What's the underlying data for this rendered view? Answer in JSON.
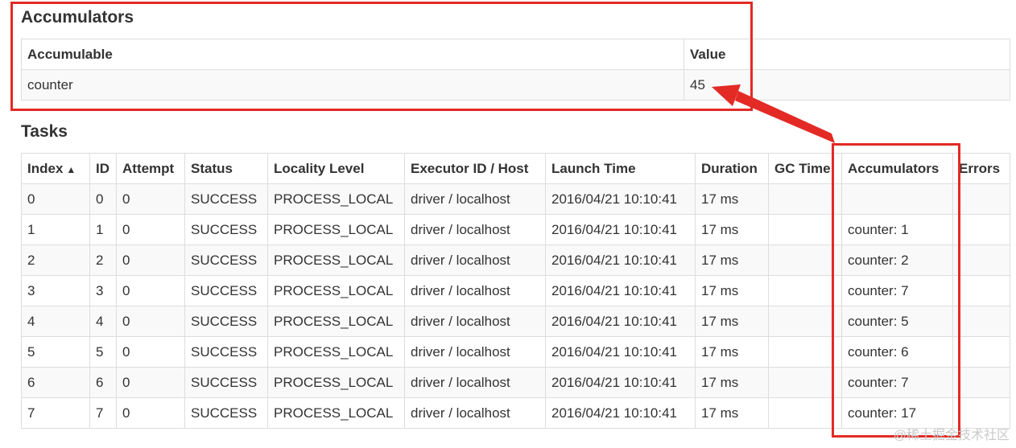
{
  "accumulators": {
    "title": "Accumulators",
    "headers": {
      "accumulable": "Accumulable",
      "value": "Value"
    },
    "rows": [
      {
        "name": "counter",
        "value": "45"
      }
    ]
  },
  "tasks": {
    "title": "Tasks",
    "headers": {
      "index": "Index",
      "index_sort": "▲",
      "id": "ID",
      "attempt": "Attempt",
      "status": "Status",
      "locality": "Locality Level",
      "executor": "Executor ID / Host",
      "launch": "Launch Time",
      "duration": "Duration",
      "gc": "GC Time",
      "accumulators": "Accumulators",
      "errors": "Errors"
    },
    "rows": [
      {
        "index": "0",
        "id": "0",
        "attempt": "0",
        "status": "SUCCESS",
        "locality": "PROCESS_LOCAL",
        "executor": "driver / localhost",
        "launch": "2016/04/21 10:10:41",
        "duration": "17 ms",
        "gc": "",
        "accumulators": "",
        "errors": ""
      },
      {
        "index": "1",
        "id": "1",
        "attempt": "0",
        "status": "SUCCESS",
        "locality": "PROCESS_LOCAL",
        "executor": "driver / localhost",
        "launch": "2016/04/21 10:10:41",
        "duration": "17 ms",
        "gc": "",
        "accumulators": "counter: 1",
        "errors": ""
      },
      {
        "index": "2",
        "id": "2",
        "attempt": "0",
        "status": "SUCCESS",
        "locality": "PROCESS_LOCAL",
        "executor": "driver / localhost",
        "launch": "2016/04/21 10:10:41",
        "duration": "17 ms",
        "gc": "",
        "accumulators": "counter: 2",
        "errors": ""
      },
      {
        "index": "3",
        "id": "3",
        "attempt": "0",
        "status": "SUCCESS",
        "locality": "PROCESS_LOCAL",
        "executor": "driver / localhost",
        "launch": "2016/04/21 10:10:41",
        "duration": "17 ms",
        "gc": "",
        "accumulators": "counter: 7",
        "errors": ""
      },
      {
        "index": "4",
        "id": "4",
        "attempt": "0",
        "status": "SUCCESS",
        "locality": "PROCESS_LOCAL",
        "executor": "driver / localhost",
        "launch": "2016/04/21 10:10:41",
        "duration": "17 ms",
        "gc": "",
        "accumulators": "counter: 5",
        "errors": ""
      },
      {
        "index": "5",
        "id": "5",
        "attempt": "0",
        "status": "SUCCESS",
        "locality": "PROCESS_LOCAL",
        "executor": "driver / localhost",
        "launch": "2016/04/21 10:10:41",
        "duration": "17 ms",
        "gc": "",
        "accumulators": "counter: 6",
        "errors": ""
      },
      {
        "index": "6",
        "id": "6",
        "attempt": "0",
        "status": "SUCCESS",
        "locality": "PROCESS_LOCAL",
        "executor": "driver / localhost",
        "launch": "2016/04/21 10:10:41",
        "duration": "17 ms",
        "gc": "",
        "accumulators": "counter: 7",
        "errors": ""
      },
      {
        "index": "7",
        "id": "7",
        "attempt": "0",
        "status": "SUCCESS",
        "locality": "PROCESS_LOCAL",
        "executor": "driver / localhost",
        "launch": "2016/04/21 10:10:41",
        "duration": "17 ms",
        "gc": "",
        "accumulators": "counter: 17",
        "errors": ""
      }
    ]
  },
  "annotation": {
    "color": "#e32a25"
  },
  "watermark": "@稀土掘金技术社区"
}
